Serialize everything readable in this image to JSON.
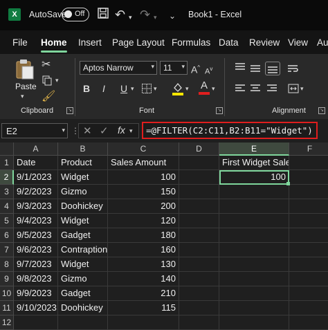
{
  "titlebar": {
    "app_logo": "X",
    "autosave_label": "AutoSave",
    "autosave_state": "Off",
    "title": "Book1  -  Excel"
  },
  "menu": [
    "File",
    "Home",
    "Insert",
    "Page Layout",
    "Formulas",
    "Data",
    "Review",
    "View",
    "Au"
  ],
  "ribbon": {
    "paste_label": "Paste",
    "clipboard_label": "Clipboard",
    "font_name": "Aptos Narrow",
    "font_size": "11",
    "font_label": "Font",
    "alignment_label": "Alignment",
    "bold": "B",
    "italic": "I",
    "underline": "U",
    "font_color_letter": "A"
  },
  "formula_bar": {
    "name_box": "E2",
    "fx": "fx",
    "formula": "=@FILTER(C2:C11,B2:B11=\"Widget\")"
  },
  "columns": [
    "A",
    "B",
    "C",
    "D",
    "E",
    "F"
  ],
  "rows": [
    "1",
    "2",
    "3",
    "4",
    "5",
    "6",
    "7",
    "8",
    "9",
    "10",
    "11",
    "12"
  ],
  "cells": {
    "A1": "Date",
    "B1": "Product",
    "C1": "Sales Amount",
    "E1": "First Widget Sale",
    "A2": "9/1/2023",
    "B2": "Widget",
    "C2": "100",
    "E2": "100",
    "A3": "9/2/2023",
    "B3": "Gizmo",
    "C3": "150",
    "A4": "9/3/2023",
    "B4": "Doohickey",
    "C4": "200",
    "A5": "9/4/2023",
    "B5": "Widget",
    "C5": "120",
    "A6": "9/5/2023",
    "B6": "Gadget",
    "C6": "180",
    "A7": "9/6/2023",
    "B7": "Contraption",
    "C7": "160",
    "A8": "9/7/2023",
    "B8": "Widget",
    "C8": "130",
    "A9": "9/8/2023",
    "B9": "Gizmo",
    "C9": "140",
    "A10": "9/9/2023",
    "B10": "Gadget",
    "C10": "210",
    "A11": "9/10/2023",
    "B11": "Doohickey",
    "C11": "115"
  },
  "accent": "#7fd69c",
  "highlight": "#e01e1e"
}
